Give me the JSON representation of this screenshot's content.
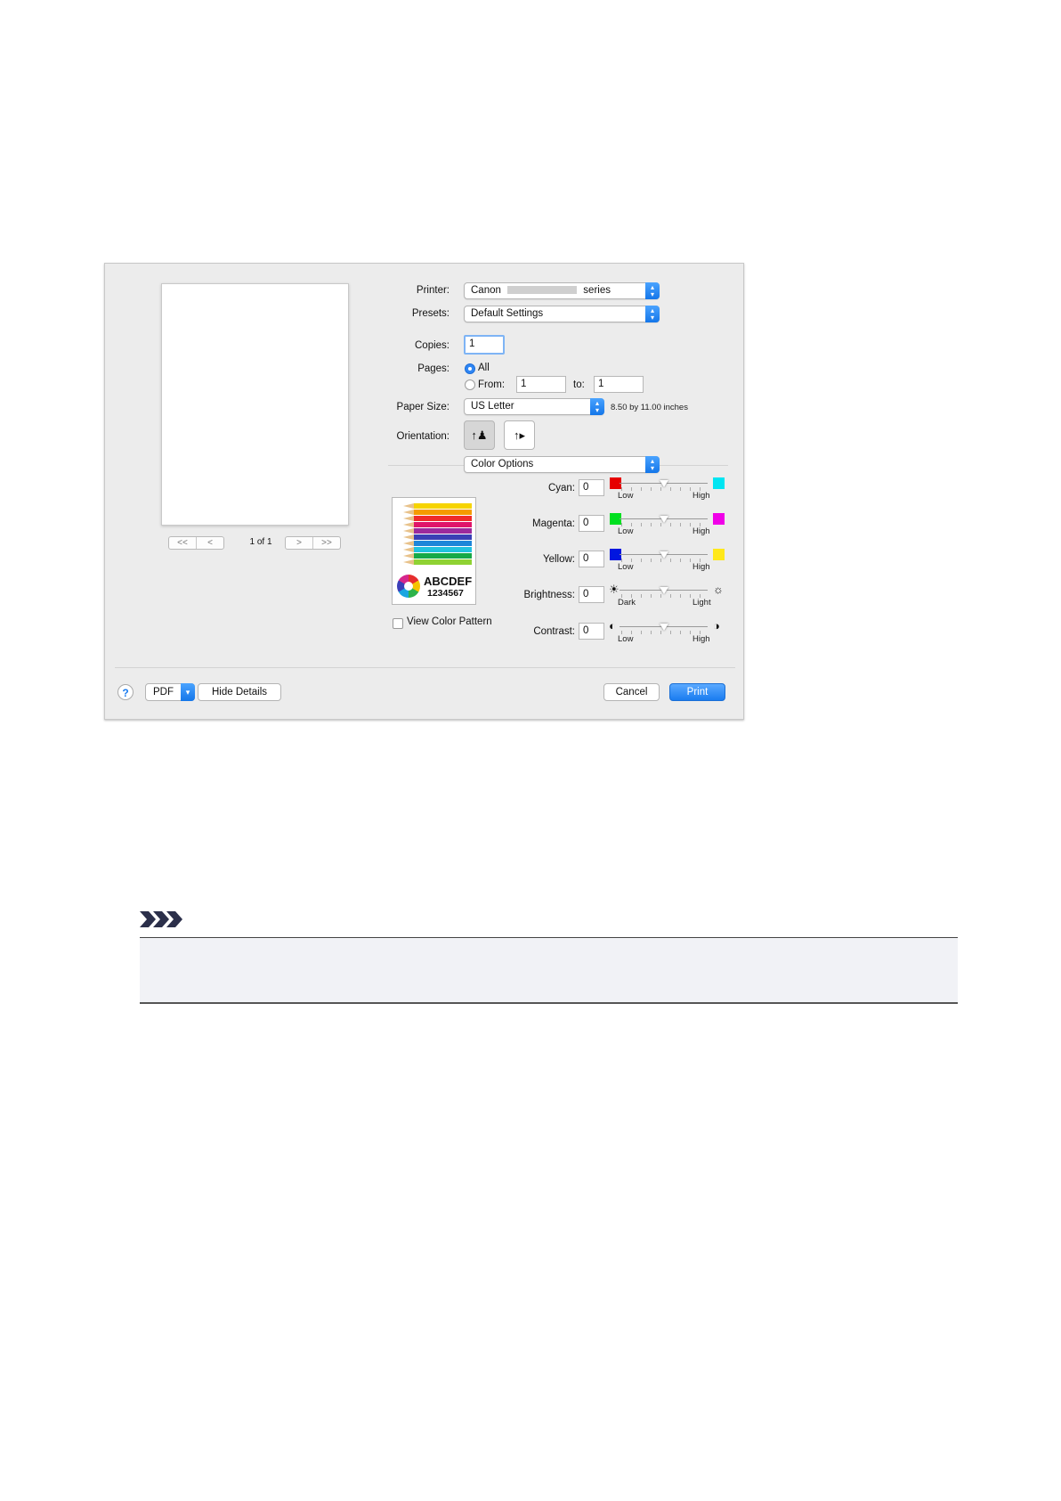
{
  "dialog": {
    "printer": {
      "label": "Printer:",
      "value_prefix": "Canon",
      "value_suffix": "series"
    },
    "presets": {
      "label": "Presets:",
      "value": "Default Settings"
    },
    "copies": {
      "label": "Copies:",
      "value": "1"
    },
    "pages": {
      "label": "Pages:",
      "all_label": "All",
      "from_label": "From:",
      "from_value": "1",
      "to_label": "to:",
      "to_value": "1",
      "selected": "All"
    },
    "paper_size": {
      "label": "Paper Size:",
      "value": "US Letter",
      "dimensions": "8.50 by 11.00 inches"
    },
    "orientation": {
      "label": "Orientation:",
      "selected": "portrait",
      "portrait_icon": "portrait-orientation-icon",
      "landscape_icon": "landscape-orientation-icon"
    },
    "panel_select": {
      "value": "Color Options"
    },
    "preview": {
      "page_count": "1 of 1",
      "nav": {
        "first": "<<",
        "prev": "<",
        "next": ">",
        "last": ">>"
      }
    },
    "color_pattern": {
      "sample_text": "ABCDEF",
      "sample_numbers": "1234567",
      "view_label": "View Color Pattern",
      "view_checked": false
    },
    "adjustments": [
      {
        "label": "Cyan:",
        "value": "0",
        "low": "Low",
        "high": "High",
        "left_color": "#e60000",
        "right_color": "#00e5f2",
        "level": 0.5
      },
      {
        "label": "Magenta:",
        "value": "0",
        "low": "Low",
        "high": "High",
        "left_color": "#00e020",
        "right_color": "#f000e8",
        "level": 0.5
      },
      {
        "label": "Yellow:",
        "value": "0",
        "low": "Low",
        "high": "High",
        "left_color": "#0016e0",
        "right_color": "#ffe81a",
        "level": 0.5
      },
      {
        "label": "Brightness:",
        "value": "0",
        "low": "Dark",
        "high": "Light",
        "left_icon": "dark-sun-icon",
        "right_icon": "light-sun-icon",
        "level": 0.5
      },
      {
        "label": "Contrast:",
        "value": "0",
        "low": "Low",
        "high": "High",
        "left_icon": "low-contrast-icon",
        "right_icon": "high-contrast-icon",
        "level": 0.5
      }
    ],
    "footer": {
      "help": "?",
      "pdf": "PDF",
      "hide_details": "Hide Details",
      "cancel": "Cancel",
      "print": "Print"
    }
  },
  "note": {
    "icon": "note-arrows-icon"
  },
  "colors": {
    "accent": "#1a7cf0",
    "dialog_bg": "#ececec",
    "note_bg": "#f1f2f6"
  }
}
